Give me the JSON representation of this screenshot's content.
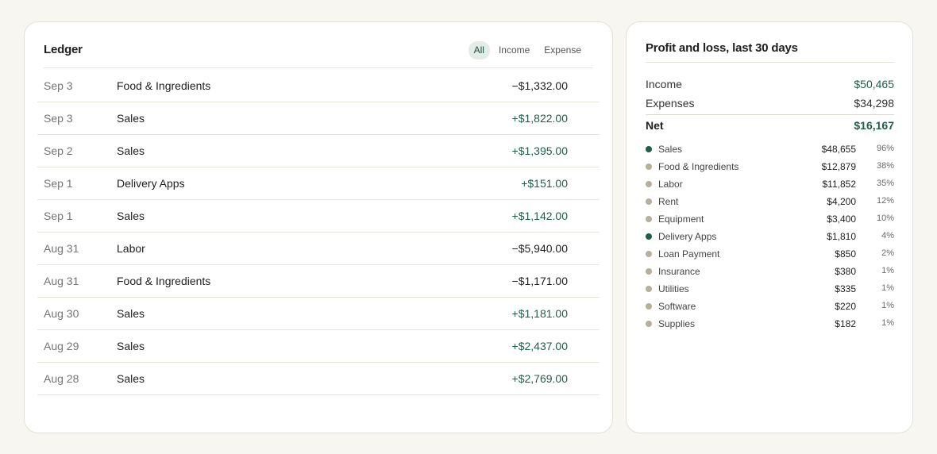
{
  "colors": {
    "income": "#1f5e4b",
    "expense_dot": "#b7ae9c",
    "income_dot": "#1f5e4b",
    "active_filter_bg": "#e3ece6"
  },
  "ledger": {
    "title": "Ledger",
    "filters": [
      {
        "label": "All",
        "active": true
      },
      {
        "label": "Income",
        "active": false
      },
      {
        "label": "Expense",
        "active": false
      }
    ],
    "rows": [
      {
        "date": "Sep 3",
        "category": "Food & Ingredients",
        "amount": "−$1,332.00",
        "type": "expense"
      },
      {
        "date": "Sep 3",
        "category": "Sales",
        "amount": "+$1,822.00",
        "type": "income"
      },
      {
        "date": "Sep 2",
        "category": "Sales",
        "amount": "+$1,395.00",
        "type": "income"
      },
      {
        "date": "Sep 1",
        "category": "Delivery Apps",
        "amount": "+$151.00",
        "type": "income"
      },
      {
        "date": "Sep 1",
        "category": "Sales",
        "amount": "+$1,142.00",
        "type": "income"
      },
      {
        "date": "Aug 31",
        "category": "Labor",
        "amount": "−$5,940.00",
        "type": "expense"
      },
      {
        "date": "Aug 31",
        "category": "Food & Ingredients",
        "amount": "−$1,171.00",
        "type": "expense"
      },
      {
        "date": "Aug 30",
        "category": "Sales",
        "amount": "+$1,181.00",
        "type": "income"
      },
      {
        "date": "Aug 29",
        "category": "Sales",
        "amount": "+$2,437.00",
        "type": "income"
      },
      {
        "date": "Aug 28",
        "category": "Sales",
        "amount": "+$2,769.00",
        "type": "income"
      }
    ]
  },
  "pnl": {
    "title": "Profit and loss, last 30 days",
    "income_label": "Income",
    "income_value": "$50,465",
    "expenses_label": "Expenses",
    "expenses_value": "$34,298",
    "net_label": "Net",
    "net_value": "$16,167",
    "breakdown": [
      {
        "name": "Sales",
        "value": "$48,655",
        "pct": "96%",
        "type": "income"
      },
      {
        "name": "Food & Ingredients",
        "value": "$12,879",
        "pct": "38%",
        "type": "expense"
      },
      {
        "name": "Labor",
        "value": "$11,852",
        "pct": "35%",
        "type": "expense"
      },
      {
        "name": "Rent",
        "value": "$4,200",
        "pct": "12%",
        "type": "expense"
      },
      {
        "name": "Equipment",
        "value": "$3,400",
        "pct": "10%",
        "type": "expense"
      },
      {
        "name": "Delivery Apps",
        "value": "$1,810",
        "pct": "4%",
        "type": "income"
      },
      {
        "name": "Loan Payment",
        "value": "$850",
        "pct": "2%",
        "type": "expense"
      },
      {
        "name": "Insurance",
        "value": "$380",
        "pct": "1%",
        "type": "expense"
      },
      {
        "name": "Utilities",
        "value": "$335",
        "pct": "1%",
        "type": "expense"
      },
      {
        "name": "Software",
        "value": "$220",
        "pct": "1%",
        "type": "expense"
      },
      {
        "name": "Supplies",
        "value": "$182",
        "pct": "1%",
        "type": "expense"
      }
    ]
  }
}
